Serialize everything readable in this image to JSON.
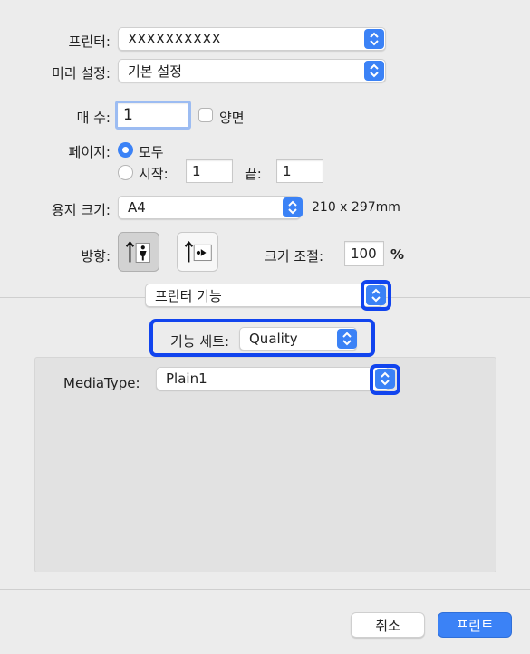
{
  "printer": {
    "label": "프린터:",
    "value": "XXXXXXXXXX"
  },
  "presets": {
    "label": "미리 설정:",
    "value": "기본 설정"
  },
  "copies": {
    "label": "매 수:",
    "value": "1",
    "duplex_label": "양면"
  },
  "pages": {
    "label": "페이지:",
    "all_label": "모두",
    "from_label": "시작:",
    "from_value": "1",
    "to_label": "끝:",
    "to_value": "1"
  },
  "paper_size": {
    "label": "용지 크기:",
    "value": "A4",
    "dimensions": "210 x 297mm"
  },
  "orientation": {
    "label": "방향:",
    "selected": "portrait"
  },
  "scale": {
    "label": "크기 조절:",
    "value": "100",
    "unit": "%"
  },
  "section_popup": {
    "value": "프린터 기능"
  },
  "feature_set": {
    "label": "기능 세트:",
    "value": "Quality"
  },
  "media_type": {
    "label": "MediaType:",
    "value": "Plain1"
  },
  "footer": {
    "cancel_label": "취소",
    "print_label": "프린트"
  },
  "colors": {
    "accent": "#3b82f6",
    "highlight": "#1144ee",
    "background": "#ececec"
  }
}
